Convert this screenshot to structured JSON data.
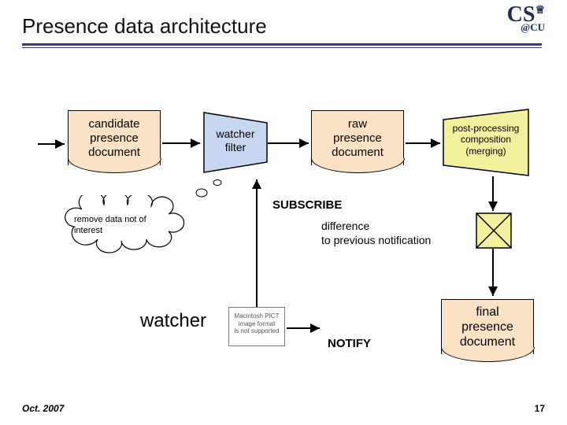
{
  "header": {
    "title": "Presence data architecture",
    "logo_main": "CS",
    "logo_at": "@",
    "logo_inst": "CU"
  },
  "nodes": {
    "candidate": {
      "l1": "candidate",
      "l2": "presence",
      "l3": "document"
    },
    "watcher_filter": {
      "l1": "watcher",
      "l2": "filter"
    },
    "raw": {
      "l1": "raw",
      "l2": "presence",
      "l3": "document"
    },
    "post": {
      "l1": "post-processing",
      "l2": "composition",
      "l3": "(merging)"
    },
    "cloud": {
      "l1": "remove data not of",
      "l2": "interest"
    },
    "watcher": "watcher",
    "final": {
      "l1": "final",
      "l2": "presence",
      "l3": "document"
    }
  },
  "labels": {
    "subscribe": "SUBSCRIBE",
    "notify": "NOTIFY",
    "diff_l1": "difference",
    "diff_l2": "to previous notification"
  },
  "missing_image": {
    "l1": "Macintosh PICT",
    "l2": "image format",
    "l3": "is not supported"
  },
  "footer": {
    "date": "Oct. 2007",
    "page": "17"
  }
}
